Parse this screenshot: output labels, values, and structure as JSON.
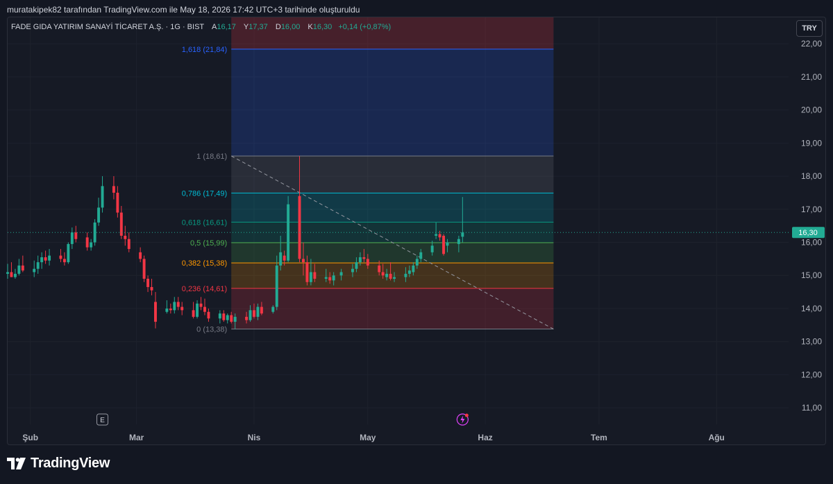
{
  "snapshot_caption": "muratakipek82 tarafından TradingView.com ile May 18, 2026 17:42 UTC+3 tarihinde oluşturuldu",
  "legend": {
    "symbol": "FADE GIDA YATIRIM SANAYİ TİCARET A.Ş. · 1G · BIST",
    "open_label": "A",
    "open": "16,17",
    "high_label": "Y",
    "high": "17,37",
    "low_label": "D",
    "low": "16,00",
    "close_label": "K",
    "close": "16,30",
    "change": "+0,14 (+0,87%)"
  },
  "currency_button": "TRY",
  "brand": "TradingView",
  "colors": {
    "up": "#22ab94",
    "down": "#f23645",
    "background": "#131722",
    "fib_0": "#787b86",
    "fib_0236": "#f23645",
    "fib_0382": "#ff9800",
    "fib_05": "#4caf50",
    "fib_0618": "#089981",
    "fib_0786": "#00bcd4",
    "fib_1": "#787b86",
    "fib_1618": "#2962ff"
  },
  "chart_data": {
    "type": "candlestick",
    "price_unit": "TRY",
    "ylim": [
      10.5,
      22.8
    ],
    "y_ticks": [
      "11,00",
      "12,00",
      "13,00",
      "14,00",
      "15,00",
      "16,00",
      "17,00",
      "18,00",
      "19,00",
      "20,00",
      "21,00",
      "22,00"
    ],
    "x_ticks": [
      {
        "label": "Şub",
        "date": "2026-02-01"
      },
      {
        "label": "Mar",
        "date": "2026-03-01"
      },
      {
        "label": "Nis",
        "date": "2026-04-01"
      },
      {
        "label": "May",
        "date": "2026-05-01"
      },
      {
        "label": "Haz",
        "date": "2026-06-01"
      },
      {
        "label": "Tem",
        "date": "2026-07-01"
      },
      {
        "label": "Ağu",
        "date": "2026-08-01"
      }
    ],
    "x_range": [
      "2026-01-26",
      "2026-08-20"
    ],
    "last_price": 16.3,
    "last_price_label": "16,30",
    "candles": [
      {
        "d": "2026-01-26",
        "o": 15.05,
        "h": 15.35,
        "l": 14.9,
        "c": 15.1
      },
      {
        "d": "2026-01-27",
        "o": 15.1,
        "h": 15.4,
        "l": 14.95,
        "c": 14.95
      },
      {
        "d": "2026-01-28",
        "o": 14.95,
        "h": 15.2,
        "l": 14.9,
        "c": 15.05
      },
      {
        "d": "2026-01-29",
        "o": 15.05,
        "h": 15.5,
        "l": 15.0,
        "c": 15.3
      },
      {
        "d": "2026-01-30",
        "o": 15.3,
        "h": 15.6,
        "l": 15.1,
        "c": 15.15
      },
      {
        "d": "2026-02-02",
        "o": 15.1,
        "h": 15.45,
        "l": 14.95,
        "c": 15.2
      },
      {
        "d": "2026-02-03",
        "o": 15.2,
        "h": 15.6,
        "l": 15.05,
        "c": 15.4
      },
      {
        "d": "2026-02-04",
        "o": 15.4,
        "h": 15.7,
        "l": 15.2,
        "c": 15.55
      },
      {
        "d": "2026-02-05",
        "o": 15.55,
        "h": 15.75,
        "l": 15.35,
        "c": 15.45
      },
      {
        "d": "2026-02-06",
        "o": 15.45,
        "h": 15.8,
        "l": 15.3,
        "c": 15.6
      },
      {
        "d": "2026-02-09",
        "o": 15.6,
        "h": 15.8,
        "l": 15.4,
        "c": 15.5
      },
      {
        "d": "2026-02-10",
        "o": 15.5,
        "h": 15.7,
        "l": 15.3,
        "c": 15.4
      },
      {
        "d": "2026-02-11",
        "o": 15.4,
        "h": 16.0,
        "l": 15.35,
        "c": 15.95
      },
      {
        "d": "2026-02-12",
        "o": 15.95,
        "h": 16.45,
        "l": 15.8,
        "c": 16.3
      },
      {
        "d": "2026-02-13",
        "o": 16.3,
        "h": 16.5,
        "l": 16.0,
        "c": 16.1
      },
      {
        "d": "2026-02-16",
        "o": 16.15,
        "h": 16.3,
        "l": 15.75,
        "c": 15.85
      },
      {
        "d": "2026-02-17",
        "o": 15.85,
        "h": 16.1,
        "l": 15.75,
        "c": 16.0
      },
      {
        "d": "2026-02-18",
        "o": 16.0,
        "h": 16.7,
        "l": 15.9,
        "c": 16.6
      },
      {
        "d": "2026-02-19",
        "o": 16.6,
        "h": 17.35,
        "l": 16.5,
        "c": 17.05
      },
      {
        "d": "2026-02-20",
        "o": 17.05,
        "h": 18.0,
        "l": 16.9,
        "c": 17.7
      },
      {
        "d": "2026-02-23",
        "o": 17.7,
        "h": 18.0,
        "l": 17.3,
        "c": 17.5
      },
      {
        "d": "2026-02-24",
        "o": 17.5,
        "h": 17.7,
        "l": 16.75,
        "c": 16.9
      },
      {
        "d": "2026-02-25",
        "o": 16.9,
        "h": 17.1,
        "l": 16.1,
        "c": 16.2
      },
      {
        "d": "2026-02-26",
        "o": 16.2,
        "h": 16.5,
        "l": 15.9,
        "c": 16.1
      },
      {
        "d": "2026-02-27",
        "o": 16.1,
        "h": 16.3,
        "l": 15.7,
        "c": 15.8
      },
      {
        "d": "2026-03-02",
        "o": 15.7,
        "h": 15.85,
        "l": 15.4,
        "c": 15.5
      },
      {
        "d": "2026-03-03",
        "o": 15.5,
        "h": 15.6,
        "l": 14.8,
        "c": 14.9
      },
      {
        "d": "2026-03-04",
        "o": 14.9,
        "h": 15.0,
        "l": 14.5,
        "c": 14.65
      },
      {
        "d": "2026-03-05",
        "o": 14.65,
        "h": 14.9,
        "l": 14.4,
        "c": 14.55
      },
      {
        "d": "2026-03-06",
        "o": 14.2,
        "h": 14.5,
        "l": 13.4,
        "c": 13.6
      },
      {
        "d": "2026-03-09",
        "o": 13.9,
        "h": 14.25,
        "l": 13.85,
        "c": 14.0
      },
      {
        "d": "2026-03-10",
        "o": 14.0,
        "h": 14.15,
        "l": 13.85,
        "c": 13.95
      },
      {
        "d": "2026-03-11",
        "o": 13.95,
        "h": 14.35,
        "l": 13.85,
        "c": 14.2
      },
      {
        "d": "2026-03-12",
        "o": 14.2,
        "h": 14.35,
        "l": 13.95,
        "c": 14.05
      },
      {
        "d": "2026-03-13",
        "o": 14.05,
        "h": 14.2,
        "l": 13.8,
        "c": 13.95
      },
      {
        "d": "2026-03-16",
        "o": 13.95,
        "h": 14.2,
        "l": 13.7,
        "c": 13.75
      },
      {
        "d": "2026-03-17",
        "o": 13.75,
        "h": 14.25,
        "l": 13.7,
        "c": 14.15
      },
      {
        "d": "2026-03-18",
        "o": 14.15,
        "h": 14.35,
        "l": 13.95,
        "c": 14.05
      },
      {
        "d": "2026-03-19",
        "o": 14.05,
        "h": 14.3,
        "l": 13.8,
        "c": 13.9
      },
      {
        "d": "2026-03-20",
        "o": 13.9,
        "h": 14.0,
        "l": 13.6,
        "c": 13.7
      },
      {
        "d": "2026-03-23",
        "o": 13.7,
        "h": 13.95,
        "l": 13.55,
        "c": 13.85
      },
      {
        "d": "2026-03-24",
        "o": 13.85,
        "h": 13.95,
        "l": 13.6,
        "c": 13.65
      },
      {
        "d": "2026-03-25",
        "o": 13.65,
        "h": 13.85,
        "l": 13.55,
        "c": 13.8
      },
      {
        "d": "2026-03-26",
        "o": 13.8,
        "h": 13.9,
        "l": 13.55,
        "c": 13.6
      },
      {
        "d": "2026-03-27",
        "o": 13.6,
        "h": 13.85,
        "l": 13.38,
        "c": 13.75
      },
      {
        "d": "2026-03-30",
        "o": 13.75,
        "h": 13.9,
        "l": 13.55,
        "c": 13.65
      },
      {
        "d": "2026-03-31",
        "o": 13.65,
        "h": 14.1,
        "l": 13.6,
        "c": 13.95
      },
      {
        "d": "2026-04-01",
        "o": 13.95,
        "h": 14.15,
        "l": 13.7,
        "c": 13.75
      },
      {
        "d": "2026-04-02",
        "o": 13.75,
        "h": 14.15,
        "l": 13.65,
        "c": 14.05
      },
      {
        "d": "2026-04-03",
        "o": 14.05,
        "h": 14.2,
        "l": 13.8,
        "c": 13.85
      },
      {
        "d": "2026-04-06",
        "o": 13.9,
        "h": 14.1,
        "l": 13.85,
        "c": 14.05
      },
      {
        "d": "2026-04-07",
        "o": 14.05,
        "h": 15.6,
        "l": 13.95,
        "c": 15.3
      },
      {
        "d": "2026-04-08",
        "o": 15.3,
        "h": 16.2,
        "l": 15.15,
        "c": 15.7
      },
      {
        "d": "2026-04-09",
        "o": 15.6,
        "h": 15.75,
        "l": 15.3,
        "c": 15.45
      },
      {
        "d": "2026-04-10",
        "o": 15.45,
        "h": 17.4,
        "l": 15.4,
        "c": 17.15
      },
      {
        "d": "2026-04-13",
        "o": 17.4,
        "h": 18.61,
        "l": 15.4,
        "c": 15.5
      },
      {
        "d": "2026-04-14",
        "o": 15.5,
        "h": 16.0,
        "l": 15.0,
        "c": 15.4
      },
      {
        "d": "2026-04-15",
        "o": 15.4,
        "h": 15.6,
        "l": 14.7,
        "c": 14.8
      },
      {
        "d": "2026-04-16",
        "o": 14.8,
        "h": 15.5,
        "l": 14.7,
        "c": 15.1
      },
      {
        "d": "2026-04-17",
        "o": 15.1,
        "h": 15.35,
        "l": 14.8,
        "c": 14.9
      },
      {
        "d": "2026-04-20",
        "o": 14.9,
        "h": 15.2,
        "l": 14.8,
        "c": 14.95
      },
      {
        "d": "2026-04-21",
        "o": 14.95,
        "h": 15.1,
        "l": 14.75,
        "c": 14.85
      },
      {
        "d": "2026-04-22",
        "o": 14.85,
        "h": 15.1,
        "l": 14.7,
        "c": 15.0
      },
      {
        "d": "2026-04-24",
        "o": 15.0,
        "h": 15.2,
        "l": 14.85,
        "c": 15.1
      },
      {
        "d": "2026-04-27",
        "o": 15.1,
        "h": 15.35,
        "l": 14.95,
        "c": 15.2
      },
      {
        "d": "2026-04-28",
        "o": 15.2,
        "h": 15.55,
        "l": 15.1,
        "c": 15.4
      },
      {
        "d": "2026-04-29",
        "o": 15.4,
        "h": 15.7,
        "l": 15.3,
        "c": 15.55
      },
      {
        "d": "2026-04-30",
        "o": 15.55,
        "h": 15.8,
        "l": 15.4,
        "c": 15.5
      },
      {
        "d": "2026-05-01",
        "o": 15.5,
        "h": 15.65,
        "l": 15.2,
        "c": 15.3
      },
      {
        "d": "2026-05-04",
        "o": 15.3,
        "h": 15.45,
        "l": 15.0,
        "c": 15.1
      },
      {
        "d": "2026-05-05",
        "o": 15.1,
        "h": 15.35,
        "l": 14.9,
        "c": 15.0
      },
      {
        "d": "2026-05-06",
        "o": 14.95,
        "h": 15.2,
        "l": 14.85,
        "c": 15.05
      },
      {
        "d": "2026-05-07",
        "o": 15.05,
        "h": 15.4,
        "l": 14.85,
        "c": 14.9
      },
      {
        "d": "2026-05-08",
        "o": 14.9,
        "h": 15.1,
        "l": 14.8,
        "c": 14.95
      },
      {
        "d": "2026-05-11",
        "o": 14.95,
        "h": 15.25,
        "l": 14.8,
        "c": 15.05
      },
      {
        "d": "2026-05-12",
        "o": 15.05,
        "h": 15.3,
        "l": 14.95,
        "c": 15.15
      },
      {
        "d": "2026-05-13",
        "o": 15.1,
        "h": 15.4,
        "l": 15.0,
        "c": 15.3
      },
      {
        "d": "2026-05-14",
        "o": 15.3,
        "h": 15.6,
        "l": 15.2,
        "c": 15.5
      },
      {
        "d": "2026-05-15",
        "o": 15.5,
        "h": 15.8,
        "l": 15.4,
        "c": 15.7
      },
      {
        "d": "2026-05-18",
        "o": 15.7,
        "h": 16.05,
        "l": 15.6,
        "c": 15.9
      },
      {
        "d": "2026-05-19",
        "o": 16.2,
        "h": 16.6,
        "l": 16.1,
        "c": 16.25
      },
      {
        "d": "2026-05-20",
        "o": 16.25,
        "h": 16.35,
        "l": 16.05,
        "c": 16.15
      },
      {
        "d": "2026-05-21",
        "o": 16.2,
        "h": 16.25,
        "l": 15.6,
        "c": 15.65
      },
      {
        "d": "2026-05-22",
        "o": 15.9,
        "h": 16.1,
        "l": 15.7,
        "c": 16.0
      },
      {
        "d": "2026-05-25",
        "o": 15.95,
        "h": 16.2,
        "l": 15.7,
        "c": 16.1
      },
      {
        "d": "2026-05-26",
        "o": 16.17,
        "h": 17.37,
        "l": 16.0,
        "c": 16.3
      }
    ],
    "fibonacci": {
      "start_date": "2026-03-26",
      "end_date": "2026-06-19",
      "trend_line": {
        "from": {
          "date": "2026-03-26",
          "price": 18.61
        },
        "to": {
          "date": "2026-06-19",
          "price": 13.38
        }
      },
      "levels": [
        {
          "ratio": 0,
          "price": 13.38,
          "label": "0 (13,38)",
          "color": "#787b86"
        },
        {
          "ratio": 0.236,
          "price": 14.61,
          "label": "0,236 (14,61)",
          "color": "#f23645"
        },
        {
          "ratio": 0.382,
          "price": 15.38,
          "label": "0,382 (15,38)",
          "color": "#ff9800"
        },
        {
          "ratio": 0.5,
          "price": 15.99,
          "label": "0,5 (15,99)",
          "color": "#4caf50"
        },
        {
          "ratio": 0.618,
          "price": 16.61,
          "label": "0,618 (16,61)",
          "color": "#089981"
        },
        {
          "ratio": 0.786,
          "price": 17.49,
          "label": "0,786 (17,49)",
          "color": "#00bcd4"
        },
        {
          "ratio": 1,
          "price": 18.61,
          "label": "1 (18,61)",
          "color": "#787b86"
        },
        {
          "ratio": 1.618,
          "price": 21.84,
          "label": "1,618 (21,84)",
          "color": "#2962ff"
        }
      ]
    },
    "event_markers": [
      {
        "date": "2026-02-20",
        "label": "E",
        "kind": "earnings"
      },
      {
        "date": "2026-05-26",
        "label": "",
        "kind": "dividend"
      }
    ]
  }
}
